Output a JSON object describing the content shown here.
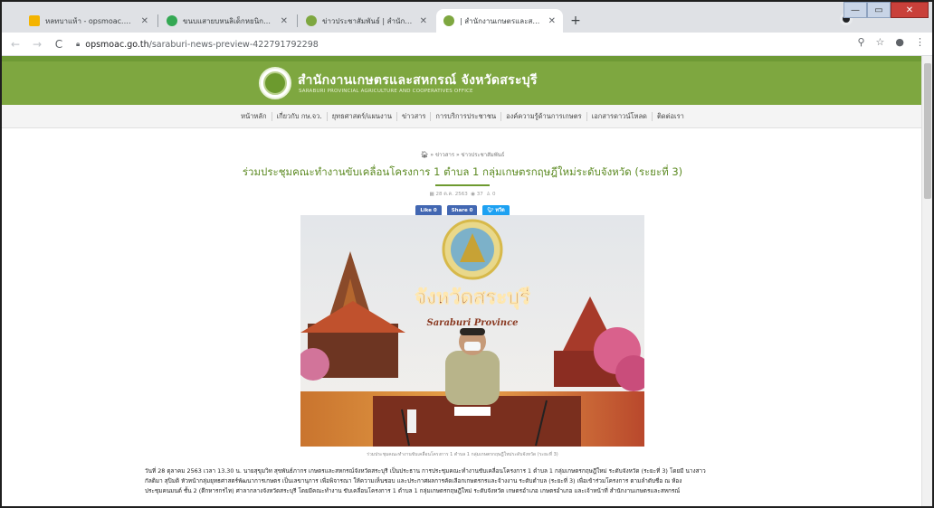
{
  "browser": {
    "tabs": [
      {
        "label": "หลทบาแห้า - opsmoac.go.th - Sm",
        "fav_color": "#f4b400",
        "active": false
      },
      {
        "label": "ขนบแสายบหนลิเด็กหยนิกศโจกิกส",
        "fav_color": "#34a853",
        "active": false
      },
      {
        "label": "ข่าวประชาสัมพันธ์ | สำนักงานเกษตรแ",
        "fav_color": "#7ea740",
        "active": false
      },
      {
        "label": "| สำนักงานเกษตรและสหกรณ์ จังหวัดส",
        "fav_color": "#7ea740",
        "active": true
      }
    ],
    "url_host": "opsmoac.go.th",
    "url_path": "/saraburi-news-preview-422791792298",
    "new_tab_glyph": "+",
    "back_glyph": "←",
    "forward_glyph": "→",
    "reload_glyph": "C",
    "zoom_glyph": "⚲",
    "star_glyph": "☆",
    "account_glyph": "●",
    "menu_glyph": "⋮",
    "close_glyph": "✕",
    "min_glyph": "—",
    "max_glyph": "▭"
  },
  "site": {
    "org_name": "สำนักงานเกษตรและสหกรณ์ จังหวัดสระบุรี",
    "org_sub": "SARABURI PROVINCIAL AGRICULTURE AND COOPERATIVES OFFICE",
    "nav": [
      "หน้าหลัก",
      "เกี่ยวกับ กษ.จว.",
      "ยุทธศาสตร์/แผนงาน",
      "ข่าวสาร",
      "การบริการประชาชน",
      "องค์ความรู้ด้านการเกษตร",
      "เอกสารดาวน์โหลด",
      "ติดต่อเรา"
    ]
  },
  "article": {
    "breadcrumb": [
      "ข่าวสาร",
      "ข่าวประชาสัมพันธ์"
    ],
    "title": "ร่วมประชุมคณะทำงานขับเคลื่อนโครงการ 1 ตำบล 1 กลุ่มเกษตรกฤษฎีใหม่ระดับจังหวัด (ระยะที่ 3)",
    "date": "28 ต.ค. 2563",
    "views": "37",
    "comments": "0",
    "share_like": "Like 0",
    "share_share": "Share 0",
    "share_tweet": "ทวีต",
    "photo_banner": "จังหวัดสระบุรี",
    "photo_banner_sub": "Saraburi Province",
    "caption": "ร่วมประชุมคณะทำงานขับเคลื่อนโครงการ 1 ตำบล 1 กลุ่มเกษตรกฤษฎีใหม่ระดับจังหวัด (ระยะที่ 3)",
    "body_lines": [
      "วันที่ 28 ตุลาคม 2563 เวลา 13.30 น. นายสุขุมวิท สุขพันธ์ภากร เกษตรและสหกรณ์จังหวัดสระบุรี เป็นประธาน การประชุมคณะทำงานขับเคลื่อนโครงการ 1 ตำบล 1 กลุ่มเกษตรกฤษฎีใหม่ ระดับจังหวัด (ระยะที่ 3) โดยมี นางสาว",
      "กัลติมา สุปิมติ หัวหน้ากลุ่มยุทธศาสตร์พัฒนาการเกษตร เป็นเลขานุการ เพื่อพิจารณา ให้ความเห็นชอบ และประกาศผลการคัดเลือกเกษตรกรและจ้างงาน ระดับตำบล (ระยะที่ 3) เพื่อเข้าร่วมโครงการ ตามลำดับชื่อ ณ ห้อง",
      "ประชุมคนมนต์ ชั้น 2 (ตึกหารกรไท) ศาลากลางจังหวัดสระบุรี โดยมีคณะทำงาน ขับเคลื่อนโครงการ 1 ตำบล 1 กลุ่มเกษตรกฤษฎีใหม่ ระดับจังหวัด เกษตรอำเภอ เกษตรอำเภอ และเจ้าหน้าที่ สำนักงานเกษตรและสหกรณ์"
    ]
  }
}
